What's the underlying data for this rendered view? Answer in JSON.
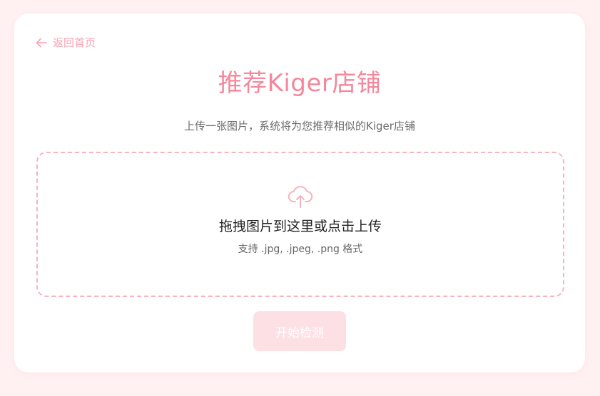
{
  "nav": {
    "back_label": "返回首页"
  },
  "header": {
    "title": "推荐Kiger店铺",
    "subtitle": "上传一张图片，系统将为您推荐相似的Kiger店铺"
  },
  "upload": {
    "icon": "cloud-upload-icon",
    "primary_text": "拖拽图片到这里或点击上传",
    "secondary_text": "支持 .jpg, .jpeg, .png 格式"
  },
  "actions": {
    "start_label": "开始检测"
  },
  "colors": {
    "page_background": "#fff1f2",
    "accent": "#f4879b",
    "dropzone_border": "#f6b3c0",
    "button_disabled_bg": "#fde0e4"
  }
}
